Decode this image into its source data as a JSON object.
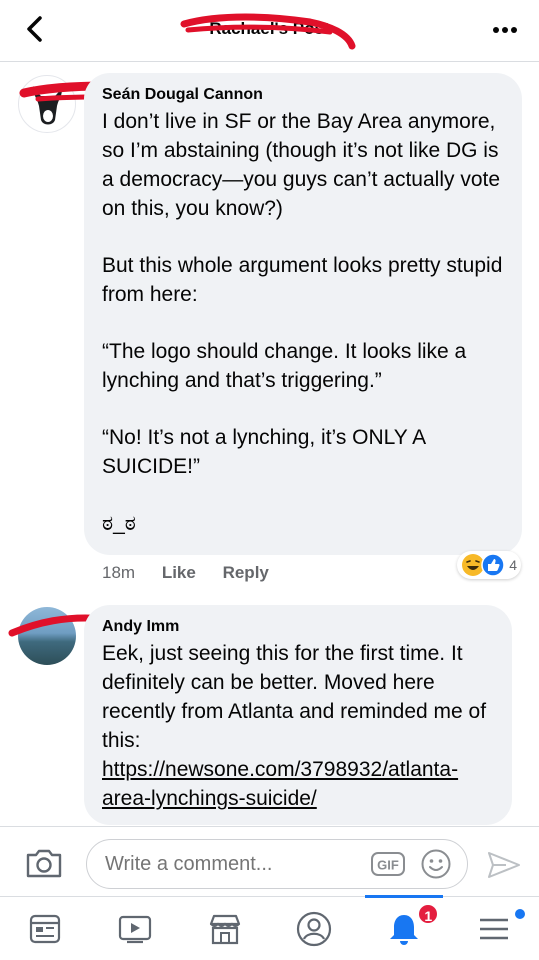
{
  "header": {
    "title": "Rachael's Post"
  },
  "comments": [
    {
      "author": "Seán Dougal Cannon",
      "paragraphs": [
        "I don’t live in SF or the Bay Area anymore, so I’m abstaining (though it’s not like DG is a democracy—you guys can’t actually vote on this, you know?)",
        "But this whole argument looks pretty stupid from here:",
        "“The logo should change. It looks like a lynching and that’s triggering.”",
        "“No! It’s not a lynching, it’s ONLY A SUICIDE!”",
        "ಠ_ಠ"
      ],
      "time": "18m",
      "like_label": "Like",
      "reply_label": "Reply",
      "reaction_count": "4",
      "reaction_icons": [
        "haha-icon",
        "like-icon"
      ]
    },
    {
      "author": "Andy Imm",
      "text": "Eek, just seeing this for the first time. It definitely can be better. Moved here recently from Atlanta and reminded me of this: ",
      "link": "https://newsone.com/3798932/atlanta-area-lynchings-suicide/"
    }
  ],
  "composer": {
    "placeholder": "Write a comment...",
    "gif_label": "GIF"
  },
  "nav": {
    "notification_badge": "1",
    "items": [
      "feed-icon",
      "watch-icon",
      "marketplace-icon",
      "profile-icon",
      "notifications-icon",
      "menu-icon"
    ]
  },
  "colors": {
    "accent": "#1877f2",
    "bubble": "#f0f2f5",
    "badge": "#e41e3f",
    "scribble": "#e0102a"
  }
}
